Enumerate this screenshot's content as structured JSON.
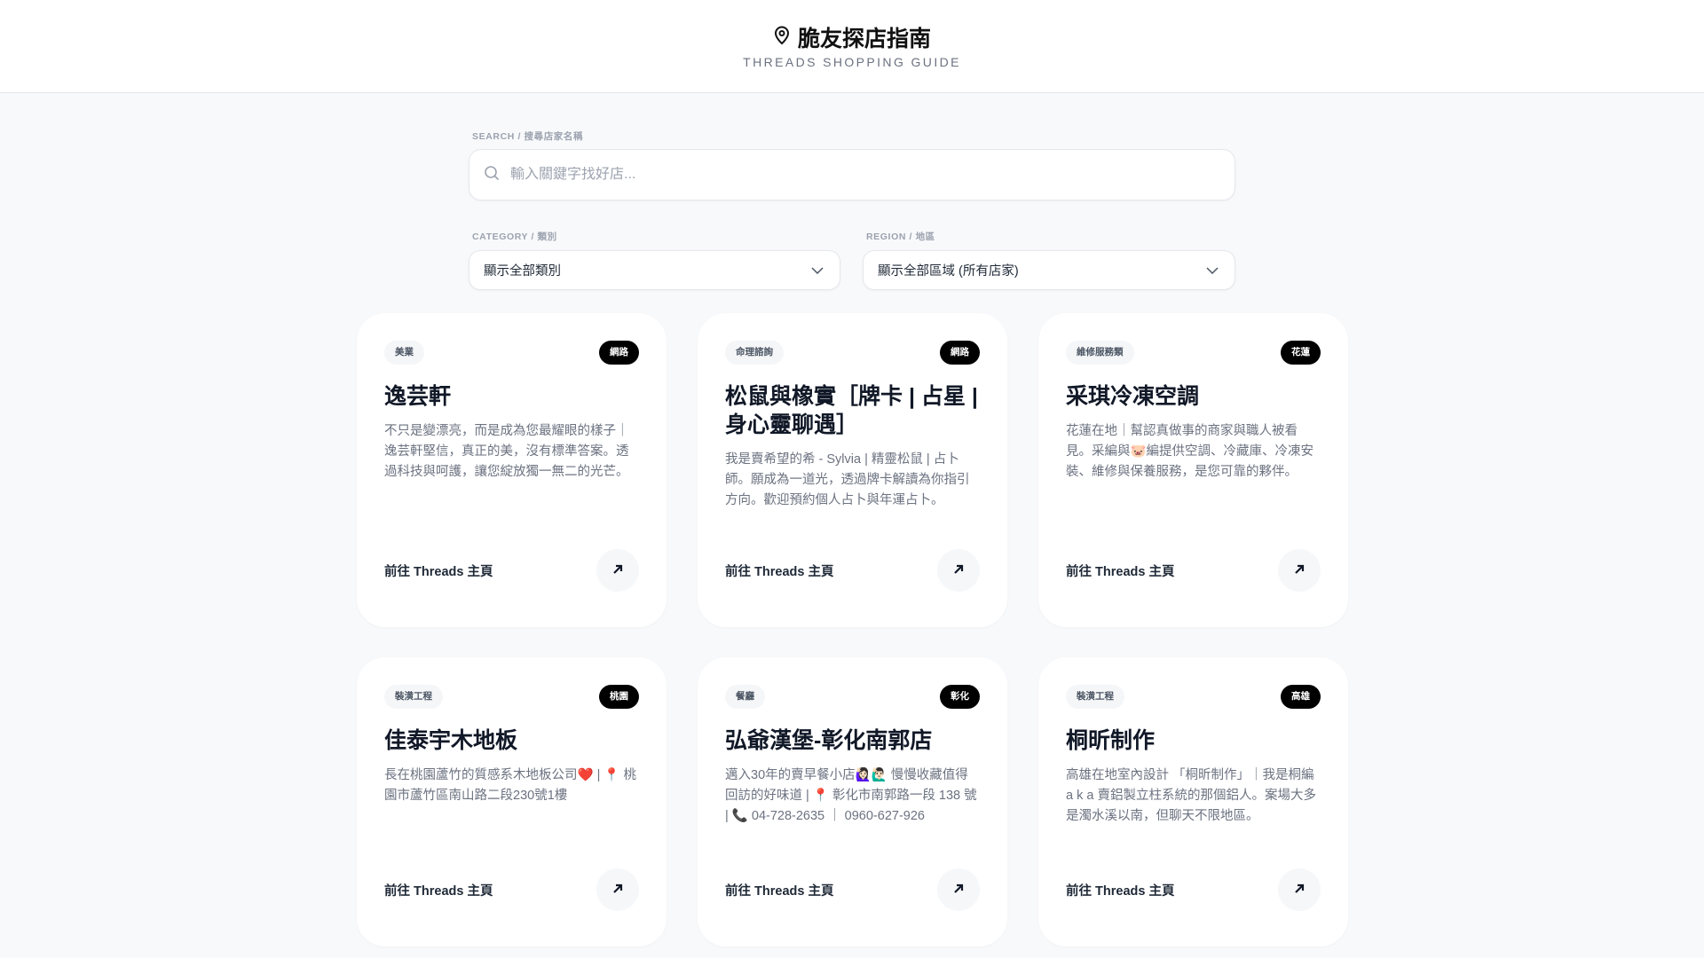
{
  "header": {
    "title": "脆友探店指南",
    "subtitle": "THREADS SHOPPING GUIDE",
    "icon": "map-pin-icon"
  },
  "search": {
    "label": "SEARCH / 搜尋店家名稱",
    "placeholder": "輸入關鍵字找好店...",
    "value": ""
  },
  "filters": {
    "category": {
      "label": "CATEGORY / 類別",
      "selected": "顯示全部類別"
    },
    "region": {
      "label": "REGION / 地區",
      "selected": "顯示全部區域 (所有店家)"
    }
  },
  "link_label": "前往 Threads 主頁",
  "cards": [
    {
      "category": "美業",
      "region": "網路",
      "name": "逸芸軒",
      "description": "不只是變漂亮，而是成為您最耀眼的樣子｜逸芸軒堅信，真正的美，沒有標準答案。透過科技與呵護，讓您綻放獨一無二的光芒。"
    },
    {
      "category": "命理諮詢",
      "region": "網路",
      "name": "松鼠與橡實［牌卡 | 占星 | 身心靈聊遇］",
      "description": "我是賣希望的希 - Sylvia | 精靈松鼠 | 占卜師。願成為一道光，透過牌卡解讀為你指引方向。歡迎預約個人占卜與年運占卜。"
    },
    {
      "category": "維修服務類",
      "region": "花蓮",
      "name": "采琪冷凍空調",
      "description": "花蓮在地｜幫認真做事的商家與職人被看見。采編與🐷編提供空調、冷藏庫、冷凍安裝、維修與保養服務，是您可靠的夥伴。"
    },
    {
      "category": "裝潢工程",
      "region": "桃園",
      "name": "佳泰宇木地板",
      "description": "長在桃園蘆竹的質感系木地板公司❤️ | 📍 桃園市蘆竹區南山路二段230號1樓"
    },
    {
      "category": "餐廳",
      "region": "彰化",
      "name": "弘爺漢堡-彰化南郭店",
      "description": "邁入30年的賣早餐小店🙋🏻‍♀️🙋🏻‍♂️ 慢慢收藏值得回訪的好味道 | 📍 彰化市南郭路一段 138 號 | 📞 04-728-2635 ｜ 0960-627-926"
    },
    {
      "category": "裝潢工程",
      "region": "高雄",
      "name": "桐昕制作",
      "description": "高雄在地室內設計 「桐昕制作」｜我是桐編 a k a 賣鋁製立柱系統的那個鋁人。案場大多是濁水溪以南，但聊天不限地區。"
    }
  ]
}
